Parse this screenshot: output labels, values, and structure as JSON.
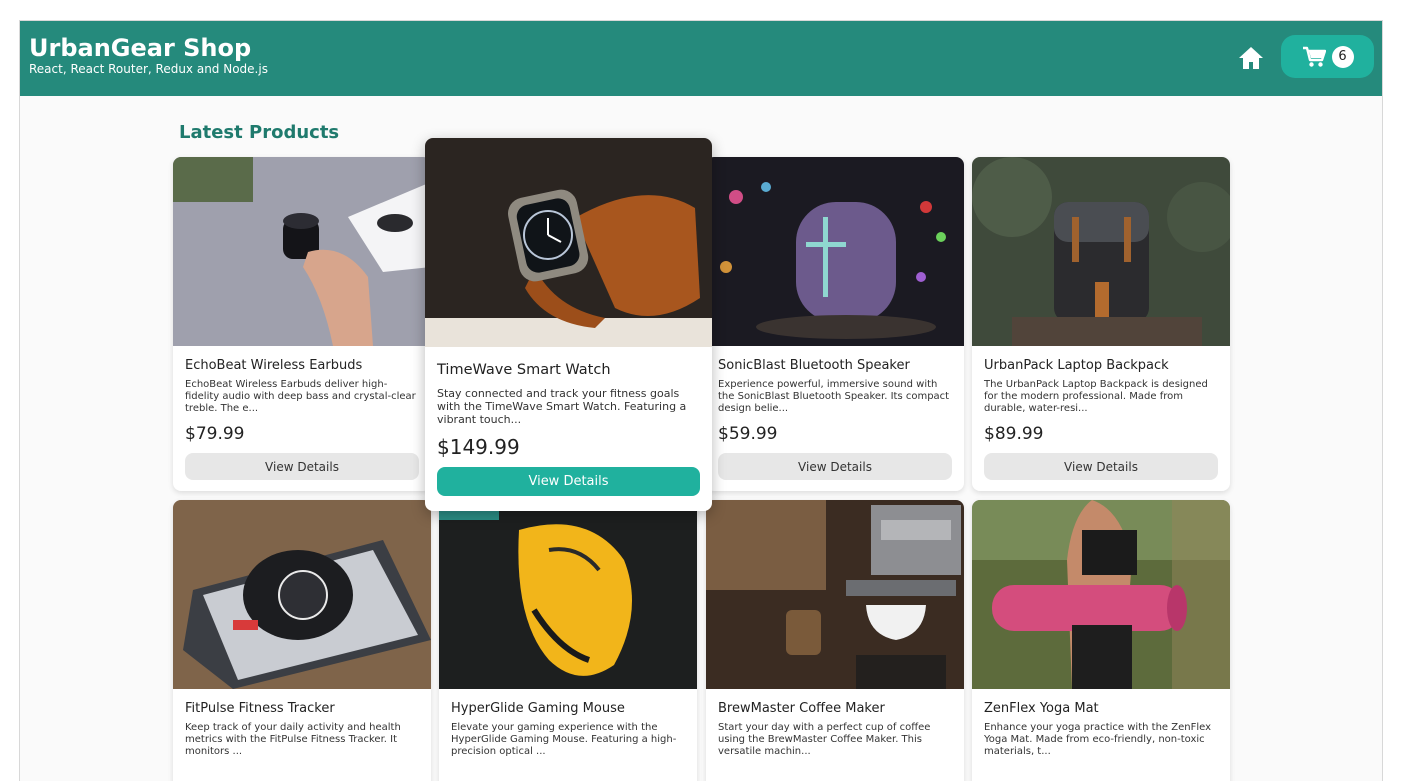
{
  "header": {
    "title": "UrbanGear Shop",
    "subtitle": "React, React Router, Redux and Node.js",
    "home_icon": "home-icon",
    "cart_icon": "cart-icon",
    "cart_count": "6"
  },
  "main": {
    "section_title": "Latest Products"
  },
  "products": [
    {
      "name": "EchoBeat Wireless Earbuds",
      "desc": "EchoBeat Wireless Earbuds deliver high-fidelity audio with deep bass and crystal-clear treble. The e...",
      "price": "$79.99",
      "button": "View Details"
    },
    {
      "name": "TimeWave Smart Watch",
      "desc": "Stay connected and track your fitness goals with the TimeWave Smart Watch. Featuring a vibrant touch...",
      "price": "$149.99",
      "button": "View Details"
    },
    {
      "name": "SonicBlast Bluetooth Speaker",
      "desc": "Experience powerful, immersive sound with the SonicBlast Bluetooth Speaker. Its compact design belie...",
      "price": "$59.99",
      "button": "View Details"
    },
    {
      "name": "UrbanPack Laptop Backpack",
      "desc": "The UrbanPack Laptop Backpack is designed for the modern professional. Made from durable, water-resi...",
      "price": "$89.99",
      "button": "View Details"
    },
    {
      "name": "FitPulse Fitness Tracker",
      "desc": "Keep track of your daily activity and health metrics with the FitPulse Fitness Tracker. It monitors ...",
      "price": "",
      "button": ""
    },
    {
      "name": "HyperGlide Gaming Mouse",
      "desc": "Elevate your gaming experience with the HyperGlide Gaming Mouse. Featuring a high-precision optical ...",
      "price": "",
      "button": ""
    },
    {
      "name": "BrewMaster Coffee Maker",
      "desc": "Start your day with a perfect cup of coffee using the BrewMaster Coffee Maker. This versatile machin...",
      "price": "",
      "button": ""
    },
    {
      "name": "ZenFlex Yoga Mat",
      "desc": "Enhance your yoga practice with the ZenFlex Yoga Mat. Made from eco-friendly, non-toxic materials, t...",
      "price": "",
      "button": ""
    }
  ],
  "colors": {
    "header_bg": "#258a7c",
    "accent": "#20b19e",
    "section_title": "#1f7a6d"
  }
}
